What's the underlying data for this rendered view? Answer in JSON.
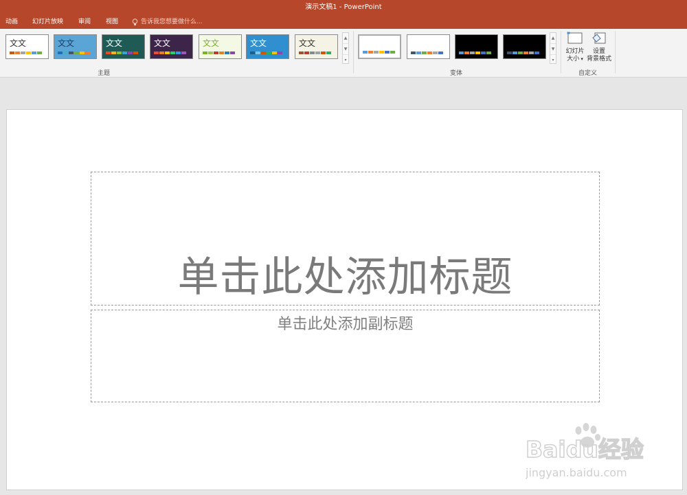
{
  "window": {
    "title": "演示文稿1 - PowerPoint"
  },
  "tabs": [
    "动画",
    "幻灯片放映",
    "审阅",
    "视图"
  ],
  "tell_me": {
    "placeholder": "告诉我您想要做什么..."
  },
  "ribbon": {
    "theme_group_label": "主题",
    "variant_group_label": "变体",
    "customize_group_label": "自定义",
    "slide_size": {
      "line1": "幻灯片",
      "line2": "大小"
    },
    "format_background": {
      "line1": "设置",
      "line2": "背景格式"
    },
    "themes": [
      {
        "glyph": "文文",
        "bg": "#ffffff",
        "text": "#333333",
        "bars": [
          "#c55a11",
          "#ed7d31",
          "#a5a5a5",
          "#ffc000",
          "#5b9bd5",
          "#70ad47"
        ]
      },
      {
        "glyph": "文文",
        "bg": "#5aa4d6",
        "text": "#1f3b58",
        "bars": [
          "#1f6fb5",
          "#4bacc6",
          "#44546a",
          "#70ad47",
          "#ffc000",
          "#ed7d31"
        ]
      },
      {
        "glyph": "文文",
        "bg": "#1f5a55",
        "text": "#ffffff",
        "bars": [
          "#e84c22",
          "#f4b41a",
          "#88bd3a",
          "#3aa5d0",
          "#8e44ad",
          "#d35400"
        ]
      },
      {
        "glyph": "文文",
        "bg": "#3d2449",
        "text": "#ffffff",
        "bars": [
          "#e74c3c",
          "#e67e22",
          "#f1c40f",
          "#2ecc71",
          "#3498db",
          "#9b59b6"
        ]
      },
      {
        "glyph": "文文",
        "bg": "#f4f9e6",
        "text": "#7ab51d",
        "bars": [
          "#7ab51d",
          "#9dc74a",
          "#c0392b",
          "#e67e22",
          "#2980b9",
          "#8e44ad"
        ]
      },
      {
        "glyph": "文文",
        "bg": "#2f8fcf",
        "text": "#ffffff",
        "bars": [
          "#1b5e8a",
          "#7fc6e8",
          "#d35400",
          "#27ae60",
          "#f1c40f",
          "#8e44ad"
        ]
      },
      {
        "glyph": "文文",
        "bg": "#f4f3e6",
        "text": "#333333",
        "bars": [
          "#a0522d",
          "#c0392b",
          "#7f8c8d",
          "#95a5a6",
          "#d35400",
          "#27ae60"
        ]
      }
    ],
    "variants": [
      {
        "bg": "#ffffff",
        "bars": [
          "#5b9bd5",
          "#ed7d31",
          "#a5a5a5",
          "#ffc000",
          "#4472c4",
          "#70ad47"
        ]
      },
      {
        "bg": "#ffffff",
        "bars": [
          "#44546a",
          "#5b9bd5",
          "#70ad47",
          "#ed7d31",
          "#a5a5a5",
          "#4472c4"
        ]
      },
      {
        "bg": "#000000",
        "bars": [
          "#5b9bd5",
          "#ed7d31",
          "#a5a5a5",
          "#ffc000",
          "#4472c4",
          "#70ad47"
        ]
      },
      {
        "bg": "#000000",
        "bars": [
          "#44546a",
          "#5b9bd5",
          "#70ad47",
          "#ed7d31",
          "#a5a5a5",
          "#4472c4"
        ]
      }
    ]
  },
  "slide": {
    "title_placeholder": "单击此处添加标题",
    "subtitle_placeholder": "单击此处添加副标题"
  },
  "watermark": {
    "brand": "Baidu经验",
    "url": "jingyan.baidu.com"
  },
  "colors": {
    "accent": "#b7472a"
  }
}
